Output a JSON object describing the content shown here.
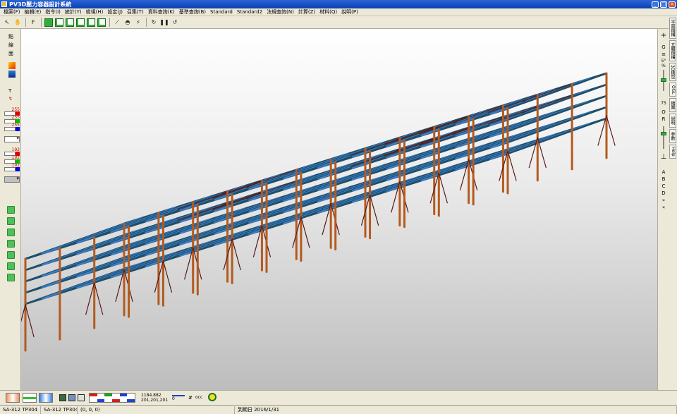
{
  "window": {
    "title": "PV3D壓力容器設計系統"
  },
  "menu": [
    "檔案(F)",
    "編輯(E)",
    "指令(I)",
    "統計(Y)",
    "檢視(H)",
    "設定(J)",
    "召集(T)",
    "資料查詢(K)",
    "基準查詢(B)",
    "Standard",
    "Standard2",
    "法規查詢(N)",
    "計算(Z)",
    "材料(Q)",
    "說明(P)"
  ],
  "left_panel": {
    "view_modes": [
      "點",
      "線",
      "面"
    ],
    "text_tool": "T",
    "color_set_1": [
      "255",
      "255",
      "255"
    ],
    "color_set_2": [
      "192",
      "192",
      "192"
    ]
  },
  "right_panel": {
    "top": [
      "+",
      "G",
      "≡",
      "5°%"
    ],
    "zoom_value": "75",
    "mode_letters": [
      "O",
      "R"
    ],
    "letters": [
      "A",
      "B",
      "C",
      "D",
      "»",
      "«"
    ]
  },
  "right_tabs": [
    "平面鋼構",
    "立體鋼構",
    "3D模型",
    "OGL",
    "繪圖",
    "說明",
    "參數",
    "Help"
  ],
  "bottom": {
    "coords_line1": "1184.882",
    "coords_line2": "201,201,201",
    "value": "0",
    "hash": "#",
    "occ": "occ"
  },
  "status": {
    "cell1": "SA-312 TP304",
    "cell2": "SA-312 TP304",
    "cell3": "(0, 0, 0)",
    "cell4": "到期日 2016/1/31"
  },
  "colors": {
    "beam": "#3b7cc4",
    "beam_dark": "#1f4f6a",
    "column": "#b45a1f",
    "brace": "#5a1a14"
  }
}
